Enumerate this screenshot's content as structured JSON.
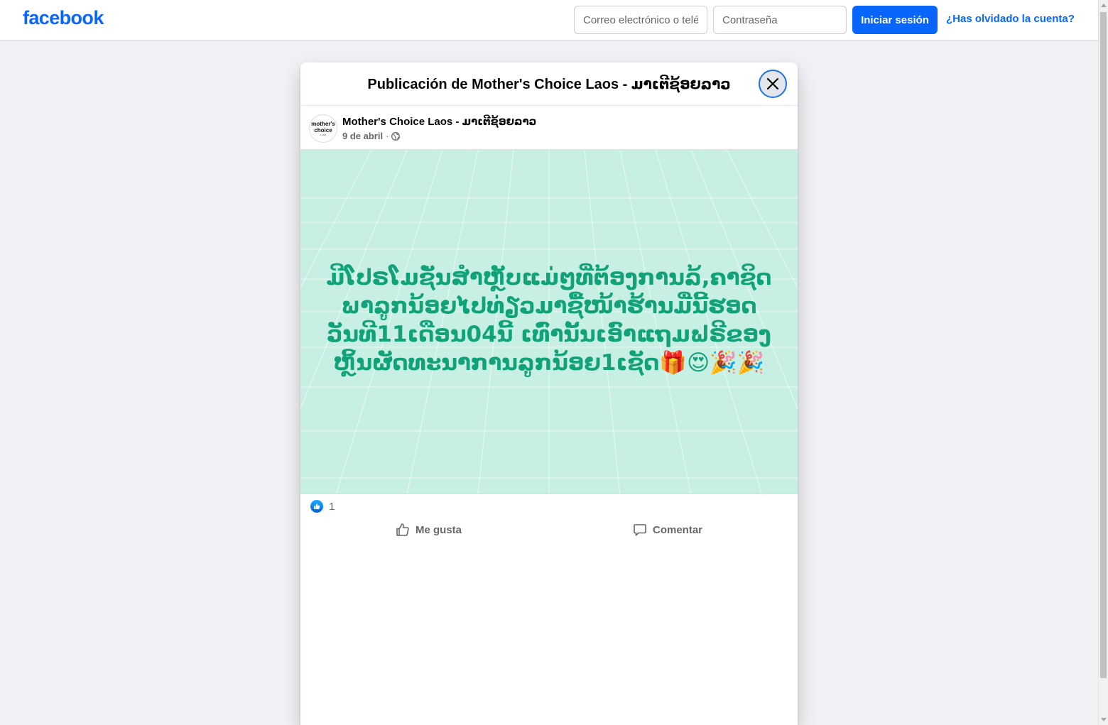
{
  "header": {
    "logo": "facebook",
    "email_placeholder": "Correo electrónico o teléfono",
    "password_placeholder": "Contraseña",
    "login_label": "Iniciar sesión",
    "forgot_label": "¿Has olvidado la cuenta?"
  },
  "modal": {
    "title": "Publicación de Mother's Choice Laos - ມາເຕີຊ້ອຍລາວ"
  },
  "post": {
    "page_name": "Mother's Choice Laos - ມາເຕີຊ້ອຍລາວ",
    "date": "9 de abril",
    "separator": "·",
    "privacy_icon": "globe-icon",
    "avatar_text": {
      "line1": "mother's",
      "line2": "choice",
      "line3": "LAOS"
    },
    "image_text": "ມີໂປຣໂມຊັ່ນສຳຫຼັບແມ່ໆທີ່ຕ້ອງການລ້,ຄາຊິດພາລູກນ້ອຍໄປທ່ຽວມາຊື້ໜ້າຮ້ານມື່ນີ້ຮອດວັນທີ11ເດືອນ04ນີ້ ເທົ່ານັ້ນເອົາແຖມຟຣີຂອງຫຼິ້ນຜັດທະນາການລູກນ້ອຍ1ເຊັດ🎁😍🎉🎉",
    "image_bg": "#c8efe3",
    "image_text_color": "#12a27a",
    "reaction_count": "1",
    "like_label": "Me gusta",
    "comment_label": "Comentar"
  },
  "colors": {
    "brand": "#0866ff",
    "page_bg": "#f0f2f5"
  }
}
